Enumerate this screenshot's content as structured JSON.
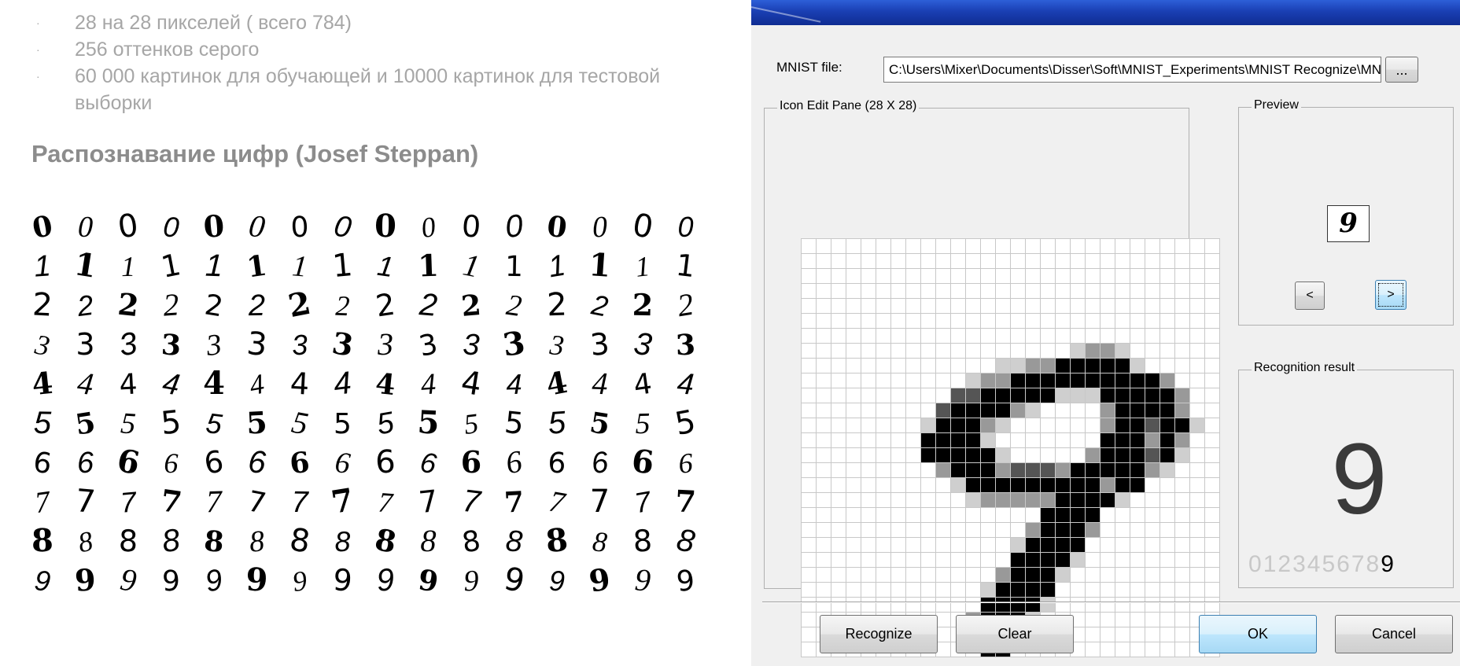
{
  "slide": {
    "bullets": [
      "28 на 28 пикселей ( всего 784)",
      "256 оттенков серого",
      "60 000 картинок для обучающей и 10000 картинок для тестовой выборки"
    ],
    "heading": "Распознавание цифр (Josef Steppan)",
    "digit_rows": [
      [
        "0",
        "0",
        "0",
        "0",
        "0",
        "0",
        "0",
        "0",
        "0",
        "0",
        "0",
        "0",
        "0",
        "0",
        "0",
        "0"
      ],
      [
        "1",
        "1",
        "1",
        "1",
        "1",
        "1",
        "1",
        "1",
        "1",
        "1",
        "1",
        "1",
        "1",
        "1",
        "1",
        "1"
      ],
      [
        "2",
        "2",
        "2",
        "2",
        "2",
        "2",
        "2",
        "2",
        "2",
        "2",
        "2",
        "2",
        "2",
        "2",
        "2",
        "2"
      ],
      [
        "3",
        "3",
        "3",
        "3",
        "3",
        "3",
        "3",
        "3",
        "3",
        "3",
        "3",
        "3",
        "3",
        "3",
        "3",
        "3"
      ],
      [
        "4",
        "4",
        "4",
        "4",
        "4",
        "4",
        "4",
        "4",
        "4",
        "4",
        "4",
        "4",
        "4",
        "4",
        "4",
        "4"
      ],
      [
        "5",
        "5",
        "5",
        "5",
        "5",
        "5",
        "5",
        "5",
        "5",
        "5",
        "5",
        "5",
        "5",
        "5",
        "5",
        "5"
      ],
      [
        "6",
        "6",
        "6",
        "6",
        "6",
        "6",
        "6",
        "6",
        "6",
        "6",
        "6",
        "6",
        "6",
        "6",
        "6",
        "6"
      ],
      [
        "7",
        "7",
        "7",
        "7",
        "7",
        "7",
        "7",
        "7",
        "7",
        "7",
        "7",
        "7",
        "7",
        "7",
        "7",
        "7"
      ],
      [
        "8",
        "8",
        "8",
        "8",
        "8",
        "8",
        "8",
        "8",
        "8",
        "8",
        "8",
        "8",
        "8",
        "8",
        "8",
        "8"
      ],
      [
        "9",
        "9",
        "9",
        "9",
        "9",
        "9",
        "9",
        "9",
        "9",
        "9",
        "9",
        "9",
        "9",
        "9",
        "9",
        "9"
      ]
    ]
  },
  "dialog": {
    "mnist_label": "MNIST file:",
    "mnist_path": "C:\\Users\\Mixer\\Documents\\Disser\\Soft\\MNIST_Experiments\\MNIST Recognize\\MN",
    "browse_label": "...",
    "edit_pane_caption": "Icon Edit Pane (28 X 28)",
    "preview_caption": "Preview",
    "preview_digit": "9",
    "prev_label": "<",
    "next_label": ">",
    "result_caption": "Recognition result",
    "result_digit": "9",
    "digit_strip": [
      "0",
      "1",
      "2",
      "3",
      "4",
      "5",
      "6",
      "7",
      "8",
      "9"
    ],
    "active_digit": "9",
    "buttons": {
      "recognize": "Recognize",
      "clear": "Clear",
      "ok": "OK",
      "cancel": "Cancel"
    },
    "colors": {
      "titlebar": "#1a3fb3",
      "cell_black": "#000000",
      "cell_dark": "#555555",
      "cell_mid": "#999999",
      "cell_light": "#cfcfcf"
    },
    "pixels": [
      "                            ",
      "                            ",
      "                            ",
      "                            ",
      "                            ",
      "                            ",
      "                            ",
      "                  LMML      ",
      "             LLMM#####L     ",
      "           LMM##########M   ",
      "          DD#####LLL#####M  ",
      "         D####ML    M####M  ",
      "        L###ML      M##D##L ",
      "        ####L       ###M#M  ",
      "        #####L     M###D#L  ",
      "         M###MDDDM#####ML   ",
      "          L#########M##     ",
      "           LMMMMM####L      ",
      "                ####        ",
      "               M###M        ",
      "              L####         ",
      "              ####L         ",
      "             M###L          ",
      "            L####           ",
      "            ####L           ",
      "           M###L            ",
      "           ####             ",
      "            ##              "
    ]
  }
}
